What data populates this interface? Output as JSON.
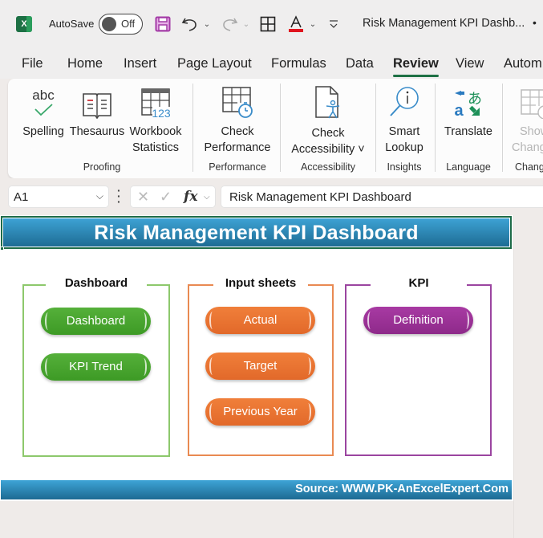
{
  "titlebar": {
    "app_icon": "excel-icon",
    "autosave_label": "AutoSave",
    "autosave_state": "Off",
    "document_title": "Risk Management KPI Dashb...",
    "title_suffix": "•",
    "quick_access": [
      "save-icon",
      "undo-icon",
      "redo-icon",
      "borders-icon",
      "font-color-icon",
      "customize-icon"
    ]
  },
  "tabs": [
    {
      "label": "File"
    },
    {
      "label": "Home"
    },
    {
      "label": "Insert"
    },
    {
      "label": "Page Layout"
    },
    {
      "label": "Formulas"
    },
    {
      "label": "Data"
    },
    {
      "label": "Review",
      "active": true
    },
    {
      "label": "View"
    },
    {
      "label": "Autom"
    }
  ],
  "ribbon": {
    "buttons": {
      "spelling": {
        "line1": "Spelling",
        "icon_text": "abc"
      },
      "thesaurus": {
        "line1": "Thesaurus"
      },
      "workbook_statistics": {
        "line1": "Workbook",
        "line2": "Statistics",
        "icon_text": "123"
      },
      "check_performance": {
        "line1": "Check",
        "line2": "Performance"
      },
      "check_accessibility": {
        "line1": "Check",
        "line2": "Accessibility ˅"
      },
      "smart_lookup": {
        "line1": "Smart",
        "line2": "Lookup"
      },
      "translate": {
        "line1": "Translate"
      },
      "show_changes": {
        "line1": "Show",
        "line2": "Chang",
        "disabled": true
      }
    },
    "groups": {
      "proofing": "Proofing",
      "performance": "Performance",
      "accessibility": "Accessibility",
      "insights": "Insights",
      "language": "Language",
      "changes": "Chang"
    }
  },
  "formula_bar": {
    "name_box": "A1",
    "cancel_symbol": "✕",
    "enter_symbol": "✓",
    "fx_label": "fx",
    "value": "Risk Management KPI Dashboard"
  },
  "sheet": {
    "header_title": "Risk Management KPI Dashboard",
    "footer_source": "Source: WWW.PK-AnExcelExpert.Com",
    "sections": {
      "dashboard": {
        "title": "Dashboard",
        "color": "#8dc86c",
        "buttons": [
          "Dashboard",
          "KPI Trend"
        ]
      },
      "input_sheets": {
        "title": "Input sheets",
        "color": "#e98a52",
        "buttons": [
          "Actual",
          "Target",
          "Previous Year"
        ]
      },
      "kpi": {
        "title": "KPI",
        "color": "#9b45a0",
        "buttons": [
          "Definition"
        ]
      }
    }
  },
  "colors": {
    "accent_green": "#1d7044",
    "header_blue_top": "#3ea4d6",
    "header_blue_bottom": "#1d6a92",
    "button_green": "#4aa530",
    "button_orange": "#e9742f",
    "button_purple": "#9b3296"
  }
}
